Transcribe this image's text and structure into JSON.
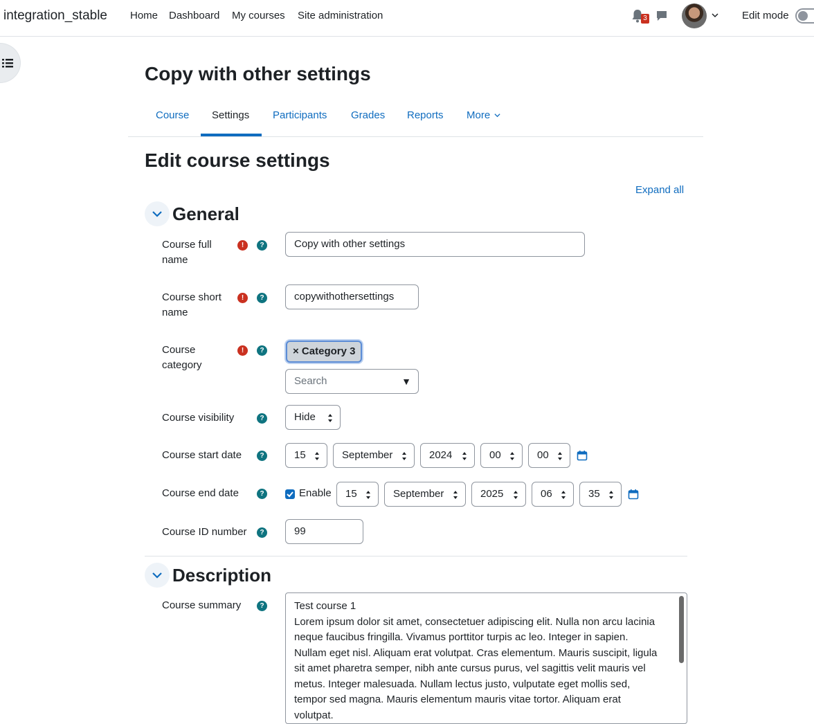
{
  "navbar": {
    "brand": "integration_stable",
    "links": [
      "Home",
      "Dashboard",
      "My courses",
      "Site administration"
    ],
    "notification_count": "3",
    "edit_mode_label": "Edit mode"
  },
  "page_title": "Copy with other settings",
  "tabs": [
    "Course",
    "Settings",
    "Participants",
    "Grades",
    "Reports",
    "More"
  ],
  "active_tab": "Settings",
  "form_title": "Edit course settings",
  "expand_all": "Expand all",
  "general": {
    "heading": "General",
    "fullname": {
      "label": "Course full name",
      "value": "Copy with other settings"
    },
    "shortname": {
      "label": "Course short name",
      "value": "copywithothersettings"
    },
    "category": {
      "label": "Course category",
      "selected": "× Category 3",
      "search_placeholder": "Search"
    },
    "visibility": {
      "label": "Course visibility",
      "value": "Hide"
    },
    "startdate": {
      "label": "Course start date",
      "day": "15",
      "month": "September",
      "year": "2024",
      "hour": "00",
      "minute": "00"
    },
    "enddate": {
      "label": "Course end date",
      "enable_label": "Enable",
      "enabled": true,
      "day": "15",
      "month": "September",
      "year": "2025",
      "hour": "06",
      "minute": "35"
    },
    "idnumber": {
      "label": "Course ID number",
      "value": "99"
    }
  },
  "description": {
    "heading": "Description",
    "summary_label": "Course summary",
    "summary_lines": [
      "Test course 1",
      "Lorem ipsum dolor sit amet, consectetuer adipiscing elit. Nulla non arcu lacinia",
      "neque faucibus fringilla. Vivamus porttitor turpis ac leo. Integer in sapien.",
      "Nullam eget nisl. Aliquam erat volutpat. Cras elementum. Mauris suscipit, ligula",
      "sit amet pharetra semper, nibh ante cursus purus, vel sagittis velit mauris vel",
      "metus. Integer malesuada. Nullam lectus justo, vulputate eget mollis sed,",
      "tempor sed magna. Mauris elementum mauris vitae tortor. Aliquam erat",
      "volutpat."
    ]
  },
  "colors": {
    "link": "#0f6cbf",
    "required": "#ca3120",
    "help": "#0f7480"
  }
}
